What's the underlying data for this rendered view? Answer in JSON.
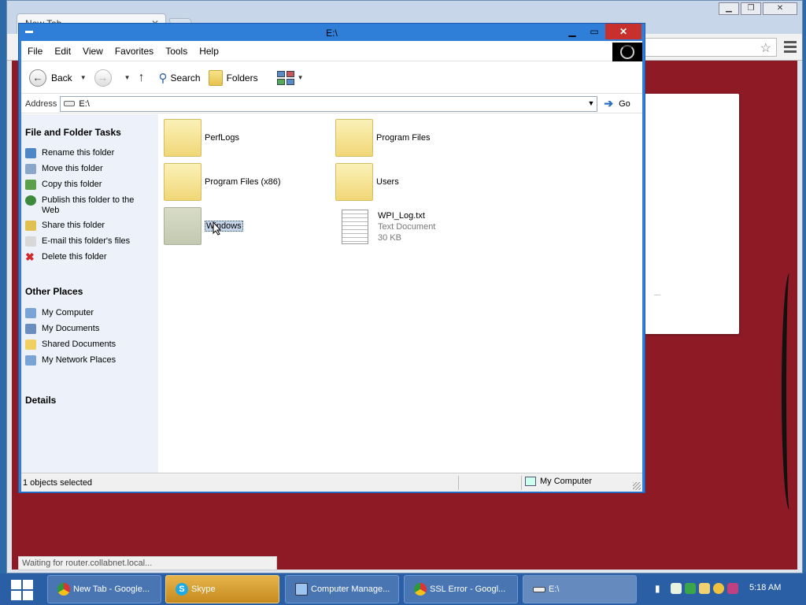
{
  "chrome": {
    "tab_title": "New Tab",
    "status": "Waiting for router.collabnet.local..."
  },
  "explorer": {
    "title": "E:\\",
    "menu": [
      "File",
      "Edit",
      "View",
      "Favorites",
      "Tools",
      "Help"
    ],
    "toolbar": {
      "back": "Back",
      "search": "Search",
      "folders": "Folders"
    },
    "address": {
      "label": "Address",
      "value": "E:\\",
      "go": "Go"
    },
    "tasks": {
      "file_folder_heading": "File and Folder Tasks",
      "file_folder_items": [
        {
          "label": "Rename this folder",
          "icon": "rename-icon",
          "color": "#4f86c6"
        },
        {
          "label": "Move this folder",
          "icon": "move-icon",
          "color": "#8aa6c8"
        },
        {
          "label": "Copy this folder",
          "icon": "copy-icon",
          "color": "#5ca04c"
        },
        {
          "label": "Publish this folder to the Web",
          "icon": "globe-icon",
          "color": "#3e8a3c"
        },
        {
          "label": "Share this folder",
          "icon": "share-icon",
          "color": "#e0c050"
        },
        {
          "label": "E-mail this folder's files",
          "icon": "mail-icon",
          "color": "#d8d8d8"
        },
        {
          "label": "Delete this folder",
          "icon": "delete-icon",
          "color": "#d4282a"
        }
      ],
      "other_places_heading": "Other Places",
      "other_places_items": [
        {
          "label": "My Computer",
          "icon": "computer-icon",
          "color": "#7aa4d6"
        },
        {
          "label": "My Documents",
          "icon": "documents-icon",
          "color": "#6a8ec0"
        },
        {
          "label": "Shared Documents",
          "icon": "shared-folder-icon",
          "color": "#f0d060"
        },
        {
          "label": "My Network Places",
          "icon": "network-icon",
          "color": "#7aa4d6"
        }
      ],
      "details_heading": "Details"
    },
    "files": [
      {
        "name": "PerfLogs",
        "type": "folder"
      },
      {
        "name": "Program Files",
        "type": "folder"
      },
      {
        "name": "Program Files (x86)",
        "type": "folder"
      },
      {
        "name": "Users",
        "type": "folder"
      },
      {
        "name": "Windows",
        "type": "folder",
        "selected": true
      },
      {
        "name": "WPI_Log.txt",
        "type": "file",
        "kind": "Text Document",
        "size": "30 KB"
      }
    ],
    "status": {
      "selection": "1 objects selected",
      "zone": "My Computer"
    }
  },
  "taskbar": {
    "items": [
      {
        "label": "New Tab - Google...",
        "icon": "chrome-icon"
      },
      {
        "label": "Skype",
        "icon": "skype-icon",
        "active": true
      },
      {
        "label": "Computer Manage...",
        "icon": "computer-management-icon"
      },
      {
        "label": "SSL Error - Googl...",
        "icon": "chrome-icon"
      },
      {
        "label": "E:\\",
        "icon": "drive-icon",
        "current": true
      }
    ],
    "clock": "5:18 AM"
  }
}
